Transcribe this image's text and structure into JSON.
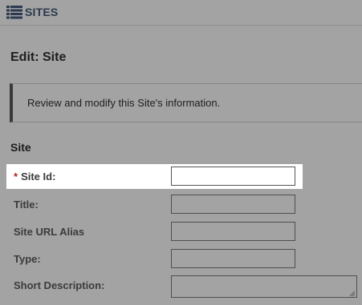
{
  "header": {
    "sites_label": "SITES",
    "sites_icon": "list-icon"
  },
  "page": {
    "title": "Edit: Site"
  },
  "info": {
    "message": "Review and modify this Site's information."
  },
  "section": {
    "title": "Site"
  },
  "fields": [
    {
      "label": "Site Id:",
      "required": true,
      "value": "",
      "type": "text"
    },
    {
      "label": "Title:",
      "required": false,
      "value": "",
      "type": "text"
    },
    {
      "label": "Site URL Alias",
      "required": false,
      "value": "",
      "type": "text"
    },
    {
      "label": "Type:",
      "required": false,
      "value": "",
      "type": "text"
    },
    {
      "label": "Short Description:",
      "required": false,
      "value": "",
      "type": "textarea"
    }
  ],
  "colors": {
    "overlay": "#a3a3a3",
    "highlight": "#ffffff",
    "required": "#b0261f",
    "link": "#2b3a4e"
  }
}
